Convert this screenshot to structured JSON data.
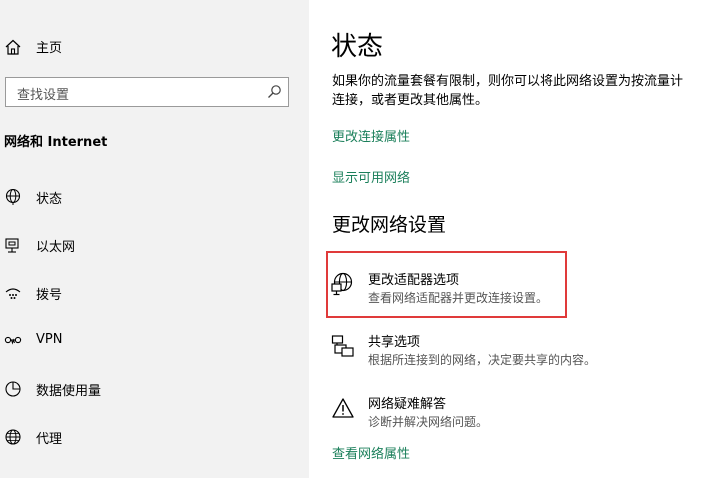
{
  "sidebar": {
    "home_label": "主页",
    "search_placeholder": "查找设置",
    "section_title": "网络和 Internet",
    "items": [
      {
        "label": "状态",
        "icon": "globe-status-icon"
      },
      {
        "label": "以太网",
        "icon": "ethernet-icon"
      },
      {
        "label": "拨号",
        "icon": "dialup-icon"
      },
      {
        "label": "VPN",
        "icon": "vpn-icon"
      },
      {
        "label": "数据使用量",
        "icon": "data-usage-icon"
      },
      {
        "label": "代理",
        "icon": "globe-icon"
      }
    ]
  },
  "main": {
    "title": "状态",
    "description_line1": "如果你的流量套餐有限制，则你可以将此网络设置为按流量计",
    "description_line2": "连接，或者更改其他属性。",
    "link_change_connection": "更改连接属性",
    "link_show_networks": "显示可用网络",
    "section_heading": "更改网络设置",
    "options": [
      {
        "title": "更改适配器选项",
        "subtitle": "查看网络适配器并更改连接设置。",
        "icon": "adapter-icon"
      },
      {
        "title": "共享选项",
        "subtitle": "根据所连接到的网络，决定要共享的内容。",
        "icon": "sharing-icon"
      },
      {
        "title": "网络疑难解答",
        "subtitle": "诊断并解决网络问题。",
        "icon": "warning-icon"
      }
    ],
    "link_view_properties": "查看网络属性"
  },
  "colors": {
    "link": "#1a7f5a",
    "highlight": "#e03a3a",
    "sidebar_bg": "#f2f2f2"
  }
}
